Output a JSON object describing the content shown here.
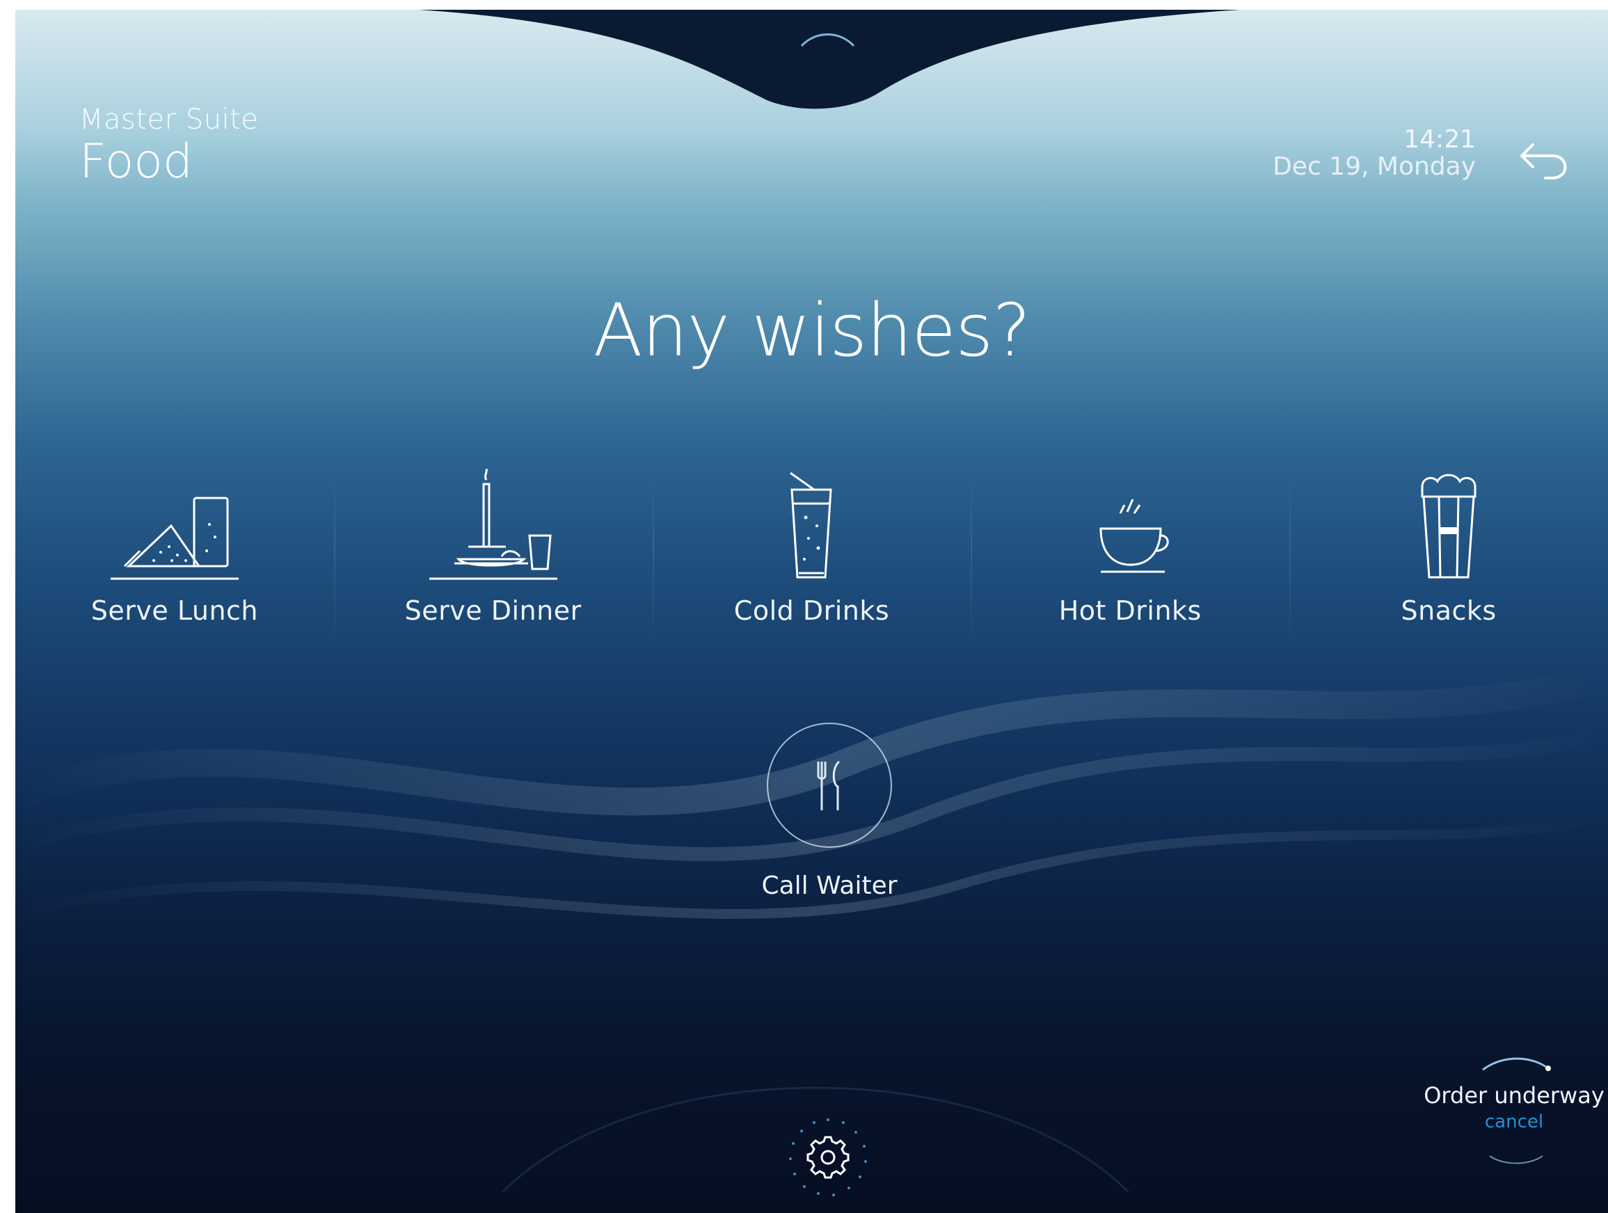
{
  "header": {
    "location": "Master Suite",
    "section": "Food",
    "time": "14:21",
    "date": "Dec 19, Monday"
  },
  "headline": "Any wishes?",
  "categories": [
    {
      "label": "Serve Lunch",
      "icon": "lunch-icon"
    },
    {
      "label": "Serve Dinner",
      "icon": "dinner-icon"
    },
    {
      "label": "Cold Drinks",
      "icon": "cold-drink-icon"
    },
    {
      "label": "Hot Drinks",
      "icon": "hot-drink-icon"
    },
    {
      "label": "Snacks",
      "icon": "snacks-icon"
    }
  ],
  "waiter": {
    "label": "Call Waiter",
    "icon": "cutlery-icon"
  },
  "order_status": {
    "text": "Order underway",
    "cancel": "cancel"
  },
  "icons": {
    "back": "back-arrow-icon",
    "settings": "gear-icon"
  },
  "colors": {
    "accent": "#2a8fd0",
    "text": "#ffffff",
    "background_dark": "#060e22"
  }
}
